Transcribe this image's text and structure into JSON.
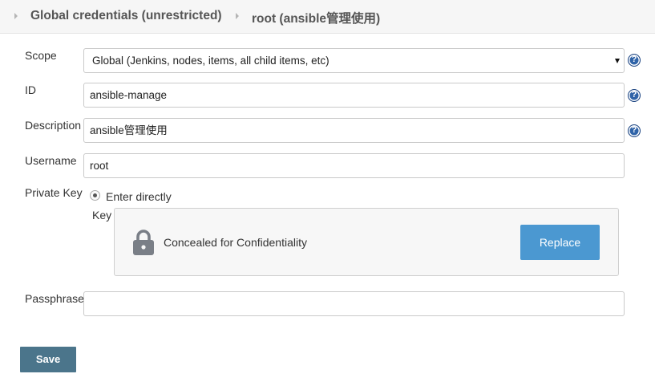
{
  "breadcrumb": {
    "items": [
      {
        "label": "Global credentials (unrestricted)"
      },
      {
        "label": "root (ansible管理使用)"
      }
    ]
  },
  "form": {
    "scope": {
      "label": "Scope",
      "selected": "Global (Jenkins, nodes, items, all child items, etc)"
    },
    "id": {
      "label": "ID",
      "value": "ansible-manage"
    },
    "description": {
      "label": "Description",
      "value": "ansible管理使用"
    },
    "username": {
      "label": "Username",
      "value": "root"
    },
    "private_key": {
      "label": "Private Key",
      "option_label": "Enter directly",
      "option_selected": true,
      "key_label": "Key",
      "concealed_text": "Concealed for Confidentiality",
      "replace_label": "Replace"
    },
    "passphrase": {
      "label": "Passphrase",
      "value": ""
    },
    "help_icon_glyph": "?",
    "save_label": "Save"
  },
  "icons": {
    "breadcrumb_separator": "triangle-right-icon",
    "help": "help-icon",
    "lock": "lock-icon",
    "select": "chevron-down-icon"
  },
  "colors": {
    "accent": "#4b98d1",
    "save": "#4b758b",
    "help": "#2f63a8"
  }
}
